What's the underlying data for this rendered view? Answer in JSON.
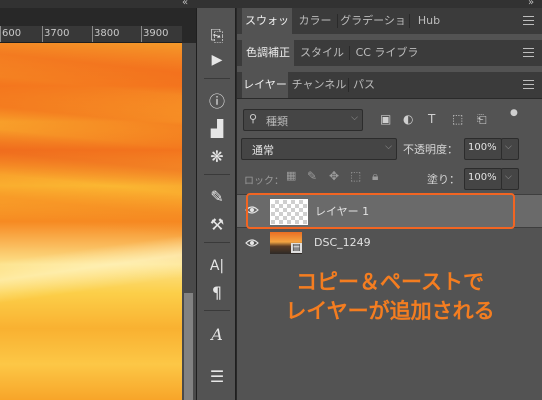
{
  "ruler": {
    "labels": [
      "600",
      "3700",
      "3800",
      "3900"
    ]
  },
  "tool_strip": {
    "tools": [
      {
        "name": "history-brush-icon",
        "glyph": "⎘"
      },
      {
        "name": "play-action-icon",
        "glyph": "▶"
      },
      {
        "name": "info-icon",
        "glyph": "ⓘ"
      },
      {
        "name": "histogram-icon",
        "glyph": "▟"
      },
      {
        "name": "navigator-wheel-icon",
        "glyph": "❋"
      },
      {
        "name": "brush-settings-icon",
        "glyph": "✎"
      },
      {
        "name": "tool-presets-icon",
        "glyph": "⚒"
      },
      {
        "name": "character-icon",
        "glyph": "A|"
      },
      {
        "name": "paragraph-icon",
        "glyph": "¶"
      },
      {
        "name": "glyphs-icon",
        "glyph": "𝒜"
      },
      {
        "name": "adjustments-icon",
        "glyph": "☰"
      }
    ]
  },
  "panel_group1": {
    "tabs": [
      "スウォッチ",
      "カラー",
      "グラデーション",
      "Hub"
    ],
    "active": 0
  },
  "panel_group2": {
    "tabs": [
      "色調補正",
      "スタイル",
      "CC ライブラリ"
    ],
    "active": 0
  },
  "panel_group3": {
    "tabs": [
      "レイヤー",
      "チャンネル",
      "パス"
    ],
    "active": 0
  },
  "layers_panel": {
    "filter_placeholder": "種類",
    "blend_mode": "通常",
    "opacity_label": "不透明度：",
    "opacity_value": "100%",
    "lock_label": "ロック：",
    "fill_label": "塗り：",
    "fill_value": "100%",
    "layers": [
      {
        "name": "レイヤー 1",
        "selected": true,
        "visible": true
      },
      {
        "name": "DSC_1249",
        "selected": false,
        "visible": true
      }
    ]
  },
  "annotation": {
    "line1": "コピー＆ペーストで",
    "line2": "レイヤーが追加される",
    "color": "#f47d20"
  },
  "colors": {
    "accent": "#f26522",
    "panel_bg": "#535353",
    "tab_bg": "#3b3b3b"
  }
}
